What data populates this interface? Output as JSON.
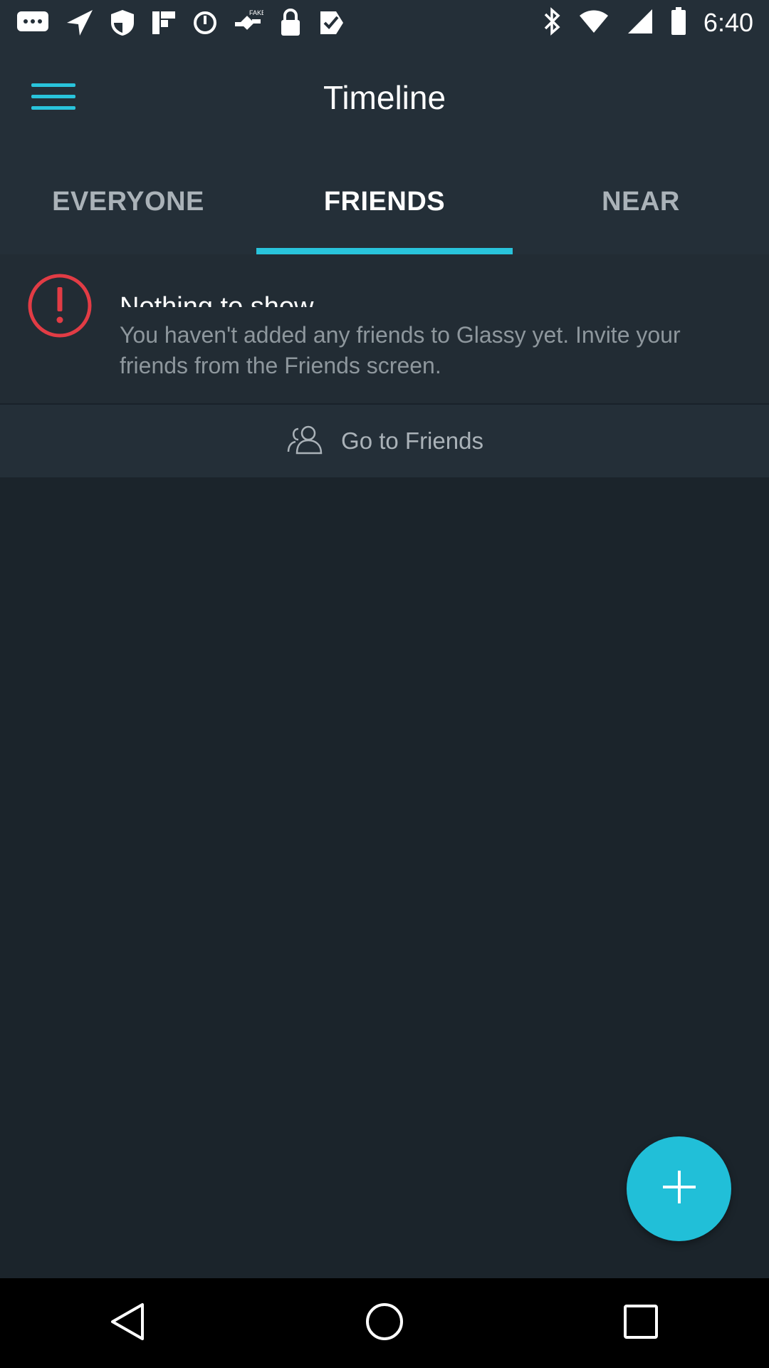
{
  "status_bar": {
    "time": "6:40",
    "left_icons": [
      "messages-icon",
      "navigation-icon",
      "shield-icon",
      "flipboard-icon",
      "data-saver-icon",
      "fake-gps-icon",
      "lock-icon",
      "check-icon"
    ],
    "right_icons": [
      "bluetooth-icon",
      "wifi-icon",
      "signal-icon",
      "battery-icon"
    ]
  },
  "app_bar": {
    "title": "Timeline",
    "menu_icon": "menu-icon"
  },
  "tabs": [
    {
      "label": "EVERYONE",
      "active": false
    },
    {
      "label": "FRIENDS",
      "active": true
    },
    {
      "label": "NEAR",
      "active": false
    }
  ],
  "empty_state": {
    "icon": "alert-icon",
    "title": "Nothing to show",
    "message": "You haven't added any friends to Glassy yet. Invite your friends from the Friends screen."
  },
  "goto_friends": {
    "icon": "friends-icon",
    "label": "Go to Friends"
  },
  "fab": {
    "icon": "plus-icon"
  },
  "nav_bar": {
    "icons": [
      "back-icon",
      "home-icon",
      "recents-icon"
    ]
  },
  "colors": {
    "accent": "#29c4dc",
    "background": "#1b242b",
    "app_bar": "#242f38",
    "alert": "#e23c45"
  }
}
